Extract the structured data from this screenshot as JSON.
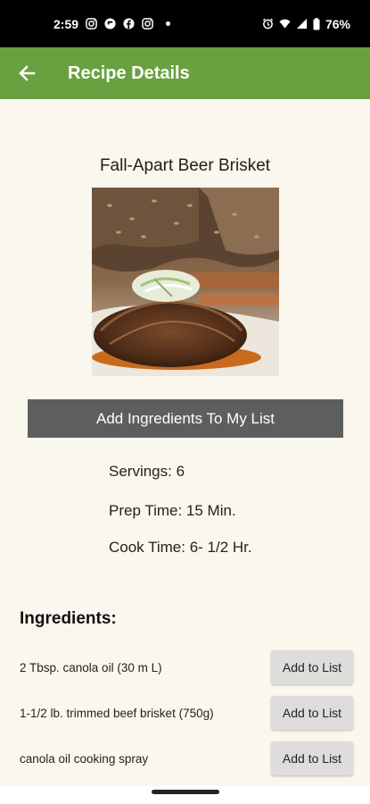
{
  "status_bar": {
    "time": "2:59",
    "battery": "76%",
    "icons": [
      "instagram-icon",
      "flipboard-icon",
      "facebook-icon",
      "instagram-icon",
      "dot-icon",
      "alarm-icon",
      "wifi-icon",
      "signal-icon",
      "battery-icon"
    ]
  },
  "app_bar": {
    "title": "Recipe Details",
    "back_icon": "arrow-left-icon"
  },
  "recipe": {
    "title": "Fall-Apart Beer Brisket",
    "image_alt": "brisket-photo"
  },
  "actions": {
    "add_all_label": "Add Ingredients To My List"
  },
  "details": {
    "servings": "Servings: 6",
    "prep_time": "Prep Time: 15 Min.",
    "cook_time": "Cook Time: 6- 1/2 Hr."
  },
  "ingredients": {
    "heading": "Ingredients:",
    "button_label": "Add to List",
    "items": [
      {
        "text": "2 Tbsp. canola oil (30 m L)"
      },
      {
        "text": "1-1/2 lb. trimmed beef brisket (750g)"
      },
      {
        "text": "canola oil cooking spray"
      }
    ]
  },
  "colors": {
    "app_bar": "#6aa140",
    "background": "#faf7ee",
    "primary_button": "#5d5f5e",
    "secondary_button": "#dedddb"
  }
}
